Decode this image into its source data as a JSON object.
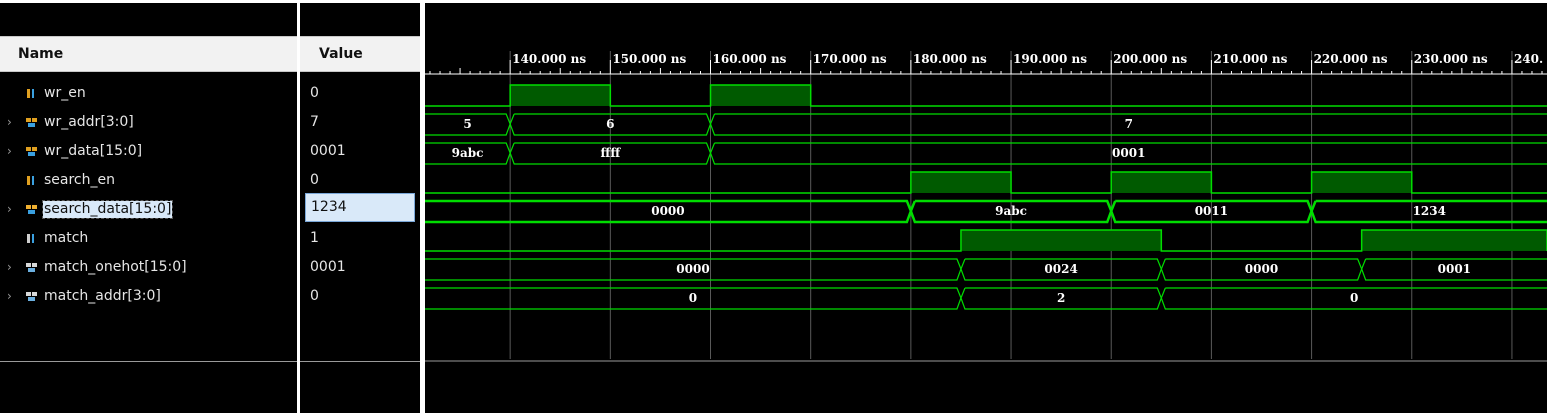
{
  "columns": {
    "name": "Name",
    "value": "Value"
  },
  "colors": {
    "wave": "#00dd00",
    "fill": "#005a00",
    "grid": "#5a5a5a",
    "ruler": "#ffffff",
    "background": "#000000"
  },
  "signals": [
    {
      "name": "wr_en",
      "value": "0",
      "kind": "bit",
      "icon": "bit-signal-icon",
      "expandable": false,
      "selected": false
    },
    {
      "name": "wr_addr[3:0]",
      "value": "7",
      "kind": "bus",
      "icon": "bus-signal-icon",
      "expandable": true,
      "selected": false
    },
    {
      "name": "wr_data[15:0]",
      "value": "0001",
      "kind": "bus",
      "icon": "bus-signal-icon",
      "expandable": true,
      "selected": false
    },
    {
      "name": "search_en",
      "value": "0",
      "kind": "bit",
      "icon": "bit-signal-icon",
      "expandable": false,
      "selected": false
    },
    {
      "name": "search_data[15:0]",
      "value": "1234",
      "kind": "bus",
      "icon": "bus-signal-icon-highlighted",
      "expandable": true,
      "selected": true
    },
    {
      "name": "match",
      "value": "1",
      "kind": "bit",
      "icon": "bit-signal-icon-white",
      "expandable": false,
      "selected": false
    },
    {
      "name": "match_onehot[15:0]",
      "value": "0001",
      "kind": "bus",
      "icon": "bus-signal-icon-white",
      "expandable": true,
      "selected": false
    },
    {
      "name": "match_addr[3:0]",
      "value": "0",
      "kind": "bus",
      "icon": "bus-signal-icon-white",
      "expandable": true,
      "selected": false
    }
  ],
  "timeline": {
    "unit": "ns",
    "view_start": 131.5,
    "view_end": 243.5,
    "ticks": [
      {
        "t": 140,
        "label": "140.000 ns"
      },
      {
        "t": 150,
        "label": "150.000 ns"
      },
      {
        "t": 160,
        "label": "160.000 ns"
      },
      {
        "t": 170,
        "label": "170.000 ns"
      },
      {
        "t": 180,
        "label": "180.000 ns"
      },
      {
        "t": 190,
        "label": "190.000 ns"
      },
      {
        "t": 200,
        "label": "200.000 ns"
      },
      {
        "t": 210,
        "label": "210.000 ns"
      },
      {
        "t": 220,
        "label": "220.000 ns"
      },
      {
        "t": 230,
        "label": "230.000 ns"
      },
      {
        "t": 240,
        "label": "240."
      }
    ]
  },
  "waves": [
    {
      "signal": "wr_en",
      "type": "bit",
      "highs": [
        [
          140,
          150
        ],
        [
          160,
          170
        ]
      ]
    },
    {
      "signal": "wr_addr[3:0]",
      "type": "bus",
      "segments": [
        {
          "start": 131.5,
          "end": 140,
          "text": "5"
        },
        {
          "start": 140,
          "end": 160,
          "text": "6"
        },
        {
          "start": 160,
          "end": 243.5,
          "text": "7"
        }
      ]
    },
    {
      "signal": "wr_data[15:0]",
      "type": "bus",
      "segments": [
        {
          "start": 131.5,
          "end": 140,
          "text": "9abc"
        },
        {
          "start": 140,
          "end": 160,
          "text": "ffff"
        },
        {
          "start": 160,
          "end": 243.5,
          "text": "0001"
        }
      ]
    },
    {
      "signal": "search_en",
      "type": "bit",
      "highs": [
        [
          180,
          190
        ],
        [
          200,
          210
        ],
        [
          220,
          230
        ]
      ]
    },
    {
      "signal": "search_data[15:0]",
      "type": "bus",
      "selected": true,
      "segments": [
        {
          "start": 131.5,
          "end": 180,
          "text": "0000"
        },
        {
          "start": 180,
          "end": 200,
          "text": "9abc"
        },
        {
          "start": 200,
          "end": 220,
          "text": "0011"
        },
        {
          "start": 220,
          "end": 243.5,
          "text": "1234"
        }
      ]
    },
    {
      "signal": "match",
      "type": "bit",
      "highs": [
        [
          185,
          205
        ],
        [
          225,
          243.5
        ]
      ]
    },
    {
      "signal": "match_onehot[15:0]",
      "type": "bus",
      "segments": [
        {
          "start": 131.5,
          "end": 185,
          "text": "0000"
        },
        {
          "start": 185,
          "end": 205,
          "text": "0024"
        },
        {
          "start": 205,
          "end": 225,
          "text": "0000"
        },
        {
          "start": 225,
          "end": 243.5,
          "text": "0001"
        }
      ]
    },
    {
      "signal": "match_addr[3:0]",
      "type": "bus",
      "segments": [
        {
          "start": 131.5,
          "end": 185,
          "text": "0"
        },
        {
          "start": 185,
          "end": 205,
          "text": "2"
        },
        {
          "start": 205,
          "end": 243.5,
          "text": "0"
        }
      ]
    }
  ]
}
